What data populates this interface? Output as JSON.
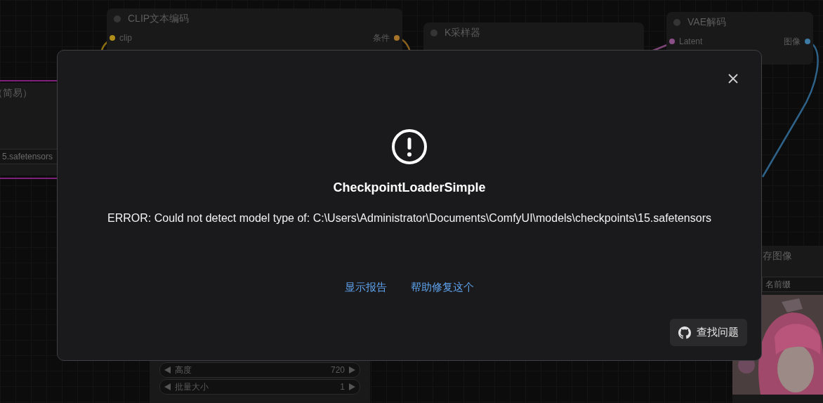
{
  "canvas": {
    "nodes": [
      {
        "title": "CLIP文本编码",
        "slots": [
          {
            "input": {
              "label": "clip",
              "color": "#b08e1a"
            },
            "output": {
              "label": "条件",
              "color": "#a8742a"
            }
          }
        ]
      },
      {
        "title": "K采样器"
      },
      {
        "title": "VAE解码",
        "slots": [
          {
            "input": {
              "label": "Latent",
              "color": "#8a4f86"
            },
            "output": {
              "label": "图像",
              "color": "#3d7ba6"
            }
          }
        ]
      },
      {
        "title": "（简易）",
        "widgets": [
          {
            "kind": "text",
            "value": "5.safetensors"
          }
        ]
      },
      {
        "widgets": [
          {
            "kind": "number",
            "label": "高度",
            "value": "720"
          },
          {
            "kind": "number",
            "label": "批量大小",
            "value": "1"
          }
        ]
      },
      {
        "title": "存图像",
        "widgets": [
          {
            "kind": "text",
            "value": "名前缀"
          }
        ],
        "preview": {
          "kind": "picture"
        }
      }
    ]
  },
  "dialog": {
    "title": "CheckpointLoaderSimple",
    "message": "ERROR: Could not detect model type of: C:\\Users\\Administrator\\Documents\\ComfyUI\\models\\checkpoints\\15.safetensors",
    "links": [
      "显示报告",
      "帮助修复这个"
    ],
    "button": "查找问题"
  }
}
